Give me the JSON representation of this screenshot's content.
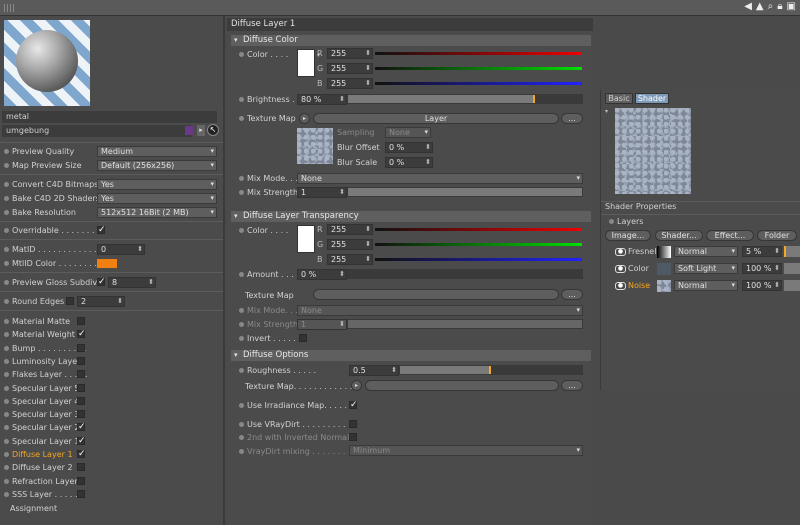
{
  "header": {
    "layer_title": "Diffuse Layer 1"
  },
  "left": {
    "material_name": "metal",
    "group_name": "umgebung",
    "preview_quality": {
      "label": "Preview Quality",
      "value": "Medium"
    },
    "map_preview_size": {
      "label": "Map Preview Size",
      "value": "Default (256x256)"
    },
    "convert_bitmaps": {
      "label": "Convert C4D Bitmaps",
      "value": "Yes"
    },
    "bake_shaders": {
      "label": "Bake C4D 2D Shaders",
      "value": "Yes"
    },
    "bake_resolution": {
      "label": "Bake Resolution",
      "value": "512x512  16Bit  (2 MB)"
    },
    "overridable": {
      "label": "Overridable . . . . . . . .",
      "checked": true
    },
    "mat_id": {
      "label": "MatID . . . . . . . . . . . .",
      "value": "0"
    },
    "mtl_id_color": {
      "label": "MtlID Color . . . . . . . .",
      "color": "#f08010"
    },
    "gloss_subdivs": {
      "label": "Preview Gloss Subdivs",
      "value": "8"
    },
    "round_edges": {
      "label": "Round Edges",
      "value": "2"
    },
    "layers": [
      {
        "label": "Material Matte",
        "checked": false
      },
      {
        "label": "Material Weight",
        "checked": true
      },
      {
        "label": "Bump . . . . . . . . . .",
        "checked": false
      },
      {
        "label": "Luminosity Layer",
        "checked": false
      },
      {
        "label": "Flakes Layer . . . . .",
        "checked": false
      },
      {
        "label": "Specular Layer 5",
        "checked": false
      },
      {
        "label": "Specular Layer 4",
        "checked": false
      },
      {
        "label": "Specular Layer 3",
        "checked": false
      },
      {
        "label": "Specular Layer 2",
        "checked": true
      },
      {
        "label": "Specular Layer 1",
        "checked": true
      },
      {
        "label": "Diffuse Layer 1",
        "checked": true,
        "active": true
      },
      {
        "label": "Diffuse Layer 2",
        "checked": false
      },
      {
        "label": "Refraction Layer",
        "checked": false
      },
      {
        "label": "SSS Layer . . . . . .",
        "checked": false
      }
    ],
    "assignment": "Assignment"
  },
  "diffuse_color": {
    "section": "Diffuse Color",
    "color_label": "Color . . . .",
    "r_label": "R",
    "g_label": "G",
    "b_label": "B",
    "r": "255",
    "g": "255",
    "b": "255",
    "brightness_label": "Brightness . .",
    "brightness": "80 %",
    "brightness_fraction": 0.8,
    "texture_map_label": "Texture Map",
    "layer_button": "Layer",
    "more_button": "...",
    "sampling_label": "Sampling",
    "sampling": "None",
    "blur_offset_label": "Blur Offset",
    "blur_offset": "0 %",
    "blur_scale_label": "Blur Scale",
    "blur_scale": "0 %",
    "mix_mode_label": "Mix Mode. . .",
    "mix_mode": "None",
    "mix_strength_label": "Mix Strength",
    "mix_strength": "1"
  },
  "transparency": {
    "section": "Diffuse Layer Transparency",
    "color_label": "Color . . . .",
    "r": "255",
    "g": "255",
    "b": "255",
    "amount_label": "Amount . . . .",
    "amount": "0 %",
    "texture_map_label": "Texture Map",
    "more_button": "...",
    "mix_mode_label": "Mix Mode. . .",
    "mix_mode": "None",
    "mix_strength_label": "Mix Strength",
    "mix_strength": "1",
    "invert_label": "Invert . . . . . ."
  },
  "options": {
    "section": "Diffuse Options",
    "roughness_label": "Roughness . . . . .",
    "roughness": "0.5",
    "roughness_fraction": 0.5,
    "texture_map_label": "Texture Map. . . . . . . . . . . .",
    "more_button": "...",
    "irradiance_label": "Use Irradiance Map. . . . . .",
    "irradiance": true,
    "vraydirt_label": "Use VRayDirt . . . . . . . . . .",
    "inverted_normals_label": "2nd with Inverted Normals",
    "vraydirt_mixing_label": "VrayDirt mixing . . . . . . . . .",
    "vraydirt_mixing": "Minimum"
  },
  "right": {
    "tab_basic": "Basic",
    "tab_shader": "Shader",
    "shader_properties": "Shader Properties",
    "layers_label": "Layers",
    "buttons": [
      "Image...",
      "Shader...",
      "Effect...",
      "Folder"
    ],
    "rows": [
      {
        "name": "Fresnel",
        "mode": "Normal",
        "pct": "5 %"
      },
      {
        "name": "Color",
        "mode": "Soft Light",
        "pct": "100 %"
      },
      {
        "name": "Noise",
        "mode": "Normal",
        "pct": "100 %"
      }
    ]
  }
}
